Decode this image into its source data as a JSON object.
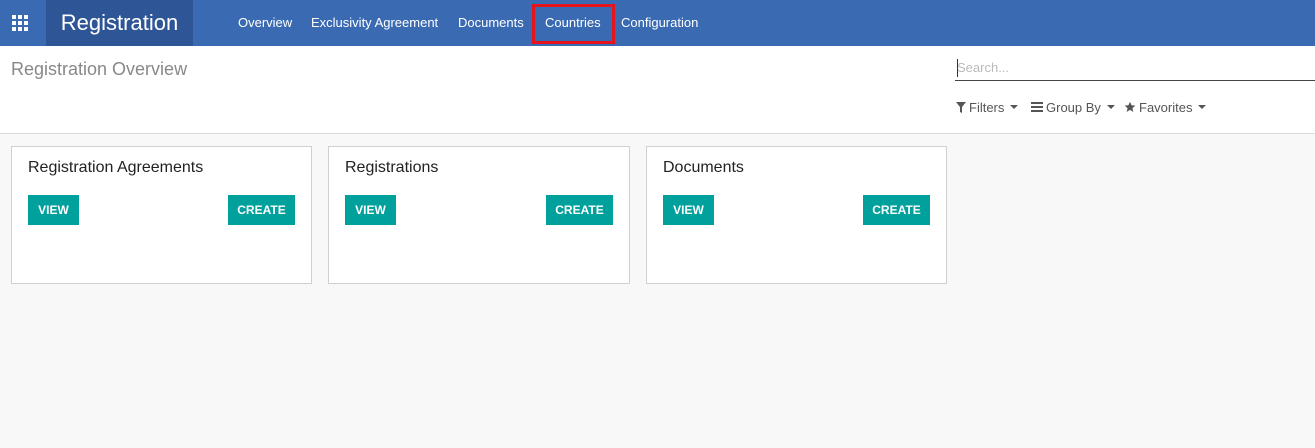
{
  "navbar": {
    "brand": "Registration",
    "menu": [
      {
        "label": "Overview"
      },
      {
        "label": "Exclusivity Agreement"
      },
      {
        "label": "Documents"
      },
      {
        "label": "Countries"
      },
      {
        "label": "Configuration"
      }
    ],
    "accent_color": "#3a6ab2",
    "brand_color": "#2e5697",
    "highlight_color": "#e3141c"
  },
  "control_panel": {
    "title": "Registration Overview",
    "search_placeholder": "Search...",
    "filters_label": "Filters",
    "groupby_label": "Group By",
    "favorites_label": "Favorites"
  },
  "cards": [
    {
      "title": "Registration Agreements",
      "view_label": "VIEW",
      "create_label": "CREATE"
    },
    {
      "title": "Registrations",
      "view_label": "VIEW",
      "create_label": "CREATE"
    },
    {
      "title": "Documents",
      "view_label": "VIEW",
      "create_label": "CREATE"
    }
  ],
  "button_color": "#00a09d"
}
